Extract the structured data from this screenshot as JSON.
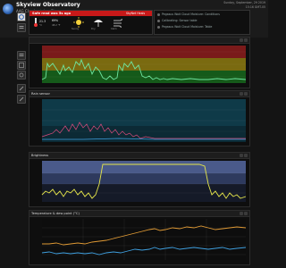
{
  "header": {
    "title": "Skyview Observatory",
    "subtitle": "AAG Cloudwatcher Site",
    "date": "Sunday, September, 29 2019",
    "time": "15:16 GMT-05"
  },
  "alert": {
    "message": "Safe read was 5s ago",
    "right_label": "SkyNet Heals",
    "tiles": [
      {
        "value": "21.3",
        "label": "°C"
      },
      {
        "value": "69%",
        "label": "48.2 °F"
      },
      {
        "value": "",
        "label": "Sunny"
      },
      {
        "value": "",
        "label": "Dry"
      },
      {
        "value": "",
        "label": "Calm"
      }
    ]
  },
  "status": {
    "rows": [
      "Pegasus Wait Cloud Moisture: Conditions",
      "Calibrating: Sensor table",
      "Pegasus Wait Cloud Moisture: Table"
    ]
  },
  "sidebar": {
    "buttons": [
      "home-icon",
      "list-icon",
      "grid-icon",
      "settings-icon",
      "pencil-icon",
      "pencil-icon"
    ]
  },
  "panels": [
    {
      "title": "",
      "y_ticks": [
        "",
        "",
        "",
        ""
      ]
    },
    {
      "title": "Rain sensor",
      "y_ticks": [
        "",
        "",
        "",
        ""
      ]
    },
    {
      "title": "Brightness",
      "y_ticks": [
        "",
        "",
        "",
        ""
      ]
    },
    {
      "title": "Temperature & dew point (°C)",
      "y_ticks": [
        "",
        "",
        "",
        ""
      ]
    }
  ],
  "colors": {
    "alert": "#c71919",
    "cloud_line": "#6fe6a0",
    "rain_line": "#d84a7a",
    "brightness_line": "#e6e64a",
    "temp_line": "#e09a35",
    "dew_line": "#3fa0e0"
  }
}
